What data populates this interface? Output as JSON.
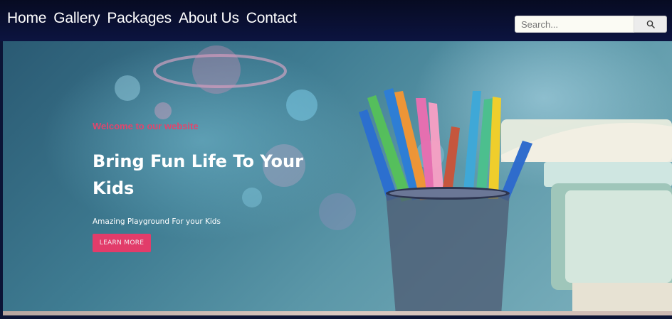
{
  "nav": {
    "links": [
      "Home",
      "Gallery",
      "Packages",
      "About Us",
      "Contact"
    ]
  },
  "search": {
    "placeholder": "Search...",
    "icon": "search-icon"
  },
  "hero": {
    "welcome": "Welcome to our website",
    "headline": "Bring Fun Life To Your Kids",
    "subtext": "Amazing Playground For your Kids",
    "button_label": "LEARN MORE"
  },
  "colors": {
    "nav_bg": "#0c1440",
    "accent": "#e23c6a",
    "welcome_text": "#e0466d",
    "hero_bg": "#3f7c92"
  }
}
